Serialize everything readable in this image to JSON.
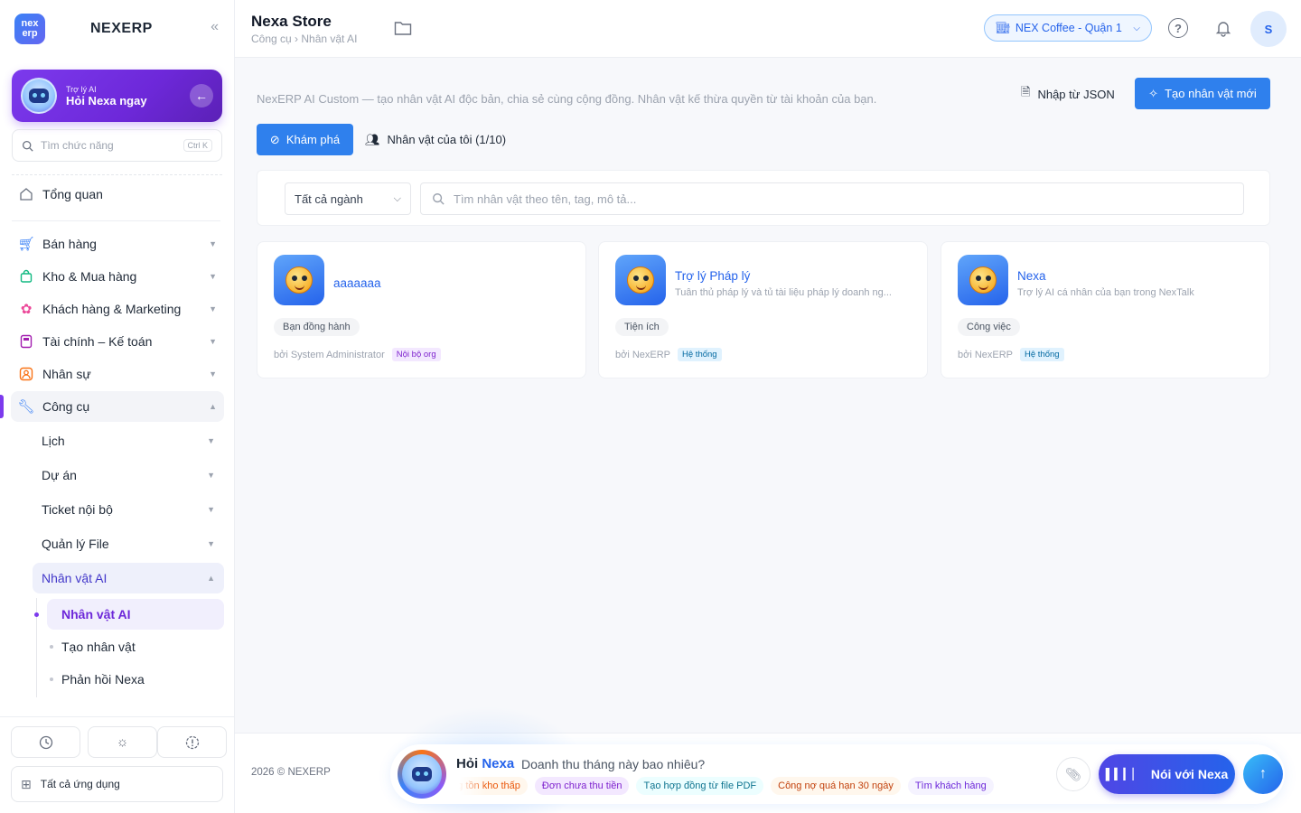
{
  "brand": {
    "logo_text_1": "nex",
    "logo_text_2": "erp",
    "name": "NEXERP"
  },
  "ai_card": {
    "small": "Trợ lý AI",
    "big": "Hỏi Nexa ngay"
  },
  "search": {
    "placeholder": "Tìm chức năng",
    "shortcut": "Ctrl K"
  },
  "nav": {
    "overview": "Tổng quan",
    "sales": "Bán hàng",
    "inventory": "Kho & Mua hàng",
    "crm": "Khách hàng & Marketing",
    "finance": "Tài chính – Kế toán",
    "hr": "Nhân sự",
    "tools": "Công cụ",
    "tools_sub": {
      "calendar": "Lịch",
      "project": "Dự án",
      "ticket": "Ticket nội bộ",
      "file": "Quản lý File",
      "persona": "Nhân vật AI"
    },
    "persona_leaves": [
      "Nhân vật AI",
      "Tạo nhân vật",
      "Phản hồi Nexa"
    ]
  },
  "sidebar_bottom": {
    "all_apps": "Tất cả ứng dụng"
  },
  "header": {
    "title": "Nexa Store",
    "breadcrumb": "Công cụ › Nhân vật AI",
    "branch": "NEX Coffee - Quận 1",
    "user_initial": "S"
  },
  "main": {
    "intro": "NexERP AI Custom — tạo nhân vật AI độc bản, chia sẻ cùng cộng đồng. Nhân vật kế thừa quyền từ tài khoản của bạn.",
    "import_label": "Nhập từ JSON",
    "create_label": "Tạo nhân vật mới",
    "tabs": {
      "explore": "Khám phá",
      "mine": "Nhân vật của tôi (1/10)"
    },
    "filter": {
      "industry": "Tất cả ngành",
      "search_placeholder": "Tìm nhân vật theo tên, tag, mô tả..."
    },
    "cards": [
      {
        "name": "aaaaaaa",
        "desc": "",
        "tag": "Bạn đồng hành",
        "by": "bởi System Administrator",
        "badge": "Nội bộ org"
      },
      {
        "name": "Trợ lý Pháp lý",
        "desc": "Tuân thủ pháp lý và tủ tài liệu pháp lý doanh ng...",
        "tag": "Tiện ích",
        "by": "bởi NexERP",
        "badge": "Hệ thống"
      },
      {
        "name": "Nexa",
        "desc": "Trợ lý AI cá nhân của bạn trong NexTalk",
        "tag": "Công việc",
        "by": "bởi NexERP",
        "badge": "Hệ thống"
      }
    ]
  },
  "footer": {
    "copyright": "2026 © NEXERP",
    "ask_prefix": "Hỏi",
    "ask_name": "Nexa",
    "ask_question": "Doanh thu tháng này bao nhiêu?",
    "chips": [
      "Hàng tồn kho thấp",
      "Đơn chưa thu tiền",
      "Tạo hợp đồng từ file PDF",
      "Công nợ quá hạn 30 ngày",
      "Tìm khách hàng"
    ],
    "talk_label": "Nói với Nexa"
  }
}
